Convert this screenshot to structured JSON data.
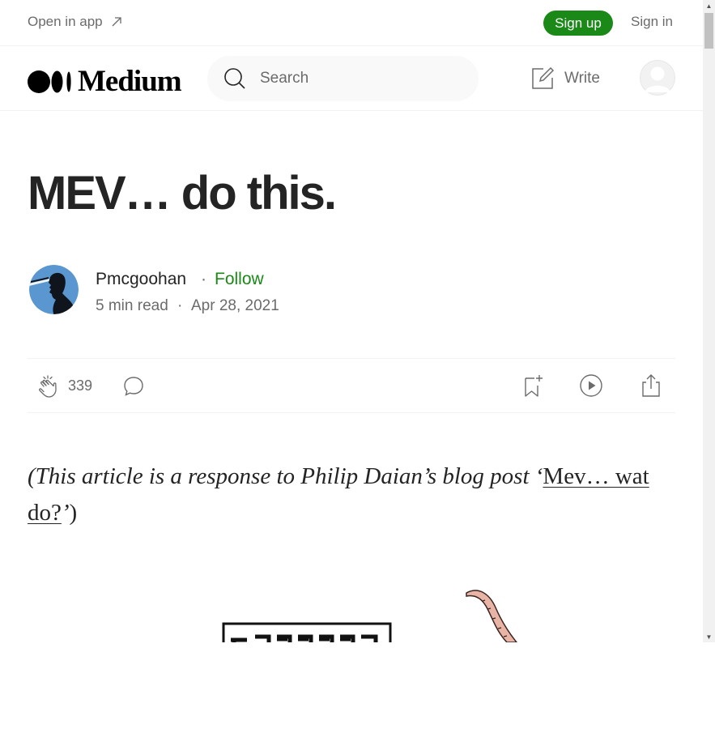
{
  "topbar": {
    "open_in_app": "Open in app",
    "sign_up": "Sign up",
    "sign_in": "Sign in"
  },
  "navbar": {
    "logo_text": "Medium",
    "search_placeholder": "Search",
    "write_label": "Write"
  },
  "article": {
    "title": "MEV… do this.",
    "author": {
      "name": "Pmcgoohan",
      "follow_label": "Follow",
      "separator": "·"
    },
    "meta": {
      "read_time": "5 min read",
      "separator": "·",
      "date": "Apr 28, 2021"
    },
    "actions": {
      "clap_count": "339"
    },
    "intro": {
      "open_paren": "(",
      "prefix": "This article is a response to Philip Daian’s blog post ‘",
      "link_text": "Mev… wat do?",
      "suffix": "’",
      "close_paren": ")"
    }
  },
  "colors": {
    "brand_green": "#1a8917",
    "text": "#242424",
    "muted": "#6b6b6b",
    "divider": "#f2f2f2"
  },
  "icons": [
    "external-arrow-icon",
    "search-icon",
    "write-icon",
    "user-avatar",
    "clap-icon",
    "comment-icon",
    "bookmark-add-icon",
    "play-icon",
    "share-icon"
  ]
}
